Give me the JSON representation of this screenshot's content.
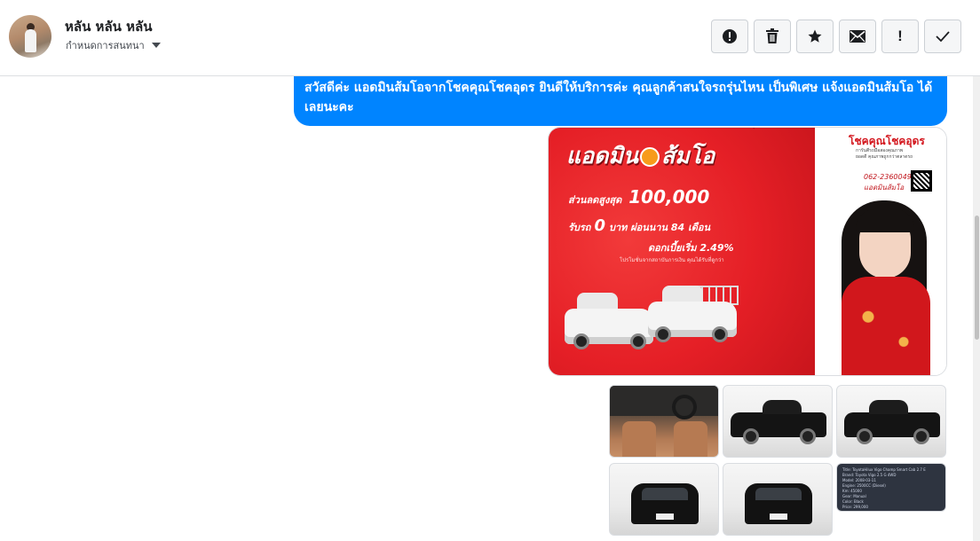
{
  "header": {
    "contact_name": "หลัน หลัน หลัน",
    "assign_label": "กำหนดการสนทนา",
    "toolbar": [
      {
        "name": "report-spam-button",
        "icon": "exclamation-circle-icon"
      },
      {
        "name": "delete-button",
        "icon": "trash-icon"
      },
      {
        "name": "star-button",
        "icon": "star-icon"
      },
      {
        "name": "mark-unread-button",
        "icon": "envelope-icon",
        "label": ""
      },
      {
        "name": "mark-important-button",
        "icon": "exclamation-icon",
        "label": "!"
      },
      {
        "name": "mark-done-button",
        "icon": "checkmark-icon"
      }
    ]
  },
  "thread": {
    "message_text": "สวัสดีค่ะ แอดมินส้มโอจากโชคคุณโชคอุดร ยินดีให้บริการค่ะ  คุณลูกค้าสนใจรถรุ่นไหน เป็นพิเศษ แจ้งแอดมินส้มโอ ได้เลยนะคะ",
    "promo": {
      "title_left": "แอดมิน",
      "title_right": "ส้มโอ",
      "discount_label": "ส่วนลดสูงสุด",
      "discount_value": "100,000",
      "down_label": "รับรถ",
      "down_value": "0",
      "down_suffix": "บาท ผ่อนนาน 84 เดือน",
      "interest": "ดอกเบี้ยเริ่ม 2.49%",
      "fine_print": "โปรโมชั่นจากสถาบันการเงิน คุณได้รับที่ดูกว่า",
      "brand": "โชคคุณโชคอุดร",
      "brand_sub": "การันตีรถมือสองคุณภาพ",
      "brand_sub2": "ยอดดี คุณภาพถูกกว่าตลาดรถ",
      "phone": "062-2360049",
      "phone_name": "แอดมินส้มโอ"
    },
    "photo_doc": [
      "Title: ToyotaHilux Vigo Champ Smart Cab 2.7 E",
      "Brand: Toyota Vigo 2.5 G 4WD",
      "Model: 2008-03-11",
      "Engine: 2500CC (Diesel)",
      "Km: 45000",
      "Gear: Manual",
      "Color: Black",
      "Price: 299,000"
    ]
  }
}
